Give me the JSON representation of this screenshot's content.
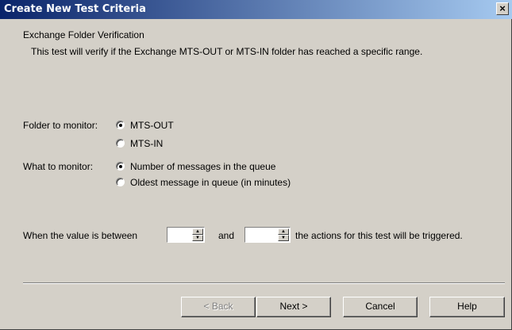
{
  "window": {
    "title": "Create New Test Criteria",
    "close_glyph": "×"
  },
  "section": {
    "title": "Exchange Folder Verification",
    "description": "This test will verify if the Exchange MTS-OUT or MTS-IN folder has reached a specific range."
  },
  "folder": {
    "label": "Folder to monitor:",
    "options": [
      "MTS-OUT",
      "MTS-IN"
    ],
    "selected": "MTS-OUT"
  },
  "monitor": {
    "label": "What to monitor:",
    "options": [
      "Number of messages in the queue",
      "Oldest message in queue (in minutes)"
    ],
    "selected": "Number of messages in the queue"
  },
  "range": {
    "prefix": "When the value is between",
    "and": "and",
    "suffix": "the actions for this test will be triggered.",
    "from_value": "",
    "to_value": ""
  },
  "buttons": {
    "back": "< Back",
    "next": "Next >",
    "cancel": "Cancel",
    "help": "Help"
  },
  "colors": {
    "titlebar_start": "#0a246a",
    "titlebar_end": "#a6caf0",
    "face": "#d4d0c8"
  }
}
